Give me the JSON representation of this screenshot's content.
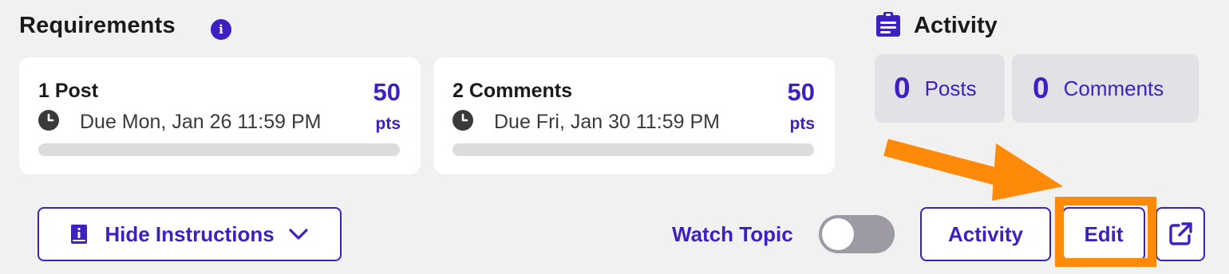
{
  "requirements": {
    "title": "Requirements",
    "info_icon": "info-icon",
    "items": [
      {
        "name": "1 Post",
        "points": "50",
        "points_unit": "pts",
        "due": "Due Mon, Jan 26 11:59 PM",
        "progress": 0
      },
      {
        "name": "2 Comments",
        "points": "50",
        "points_unit": "pts",
        "due": "Due Fri, Jan 30 11:59 PM",
        "progress": 0
      }
    ]
  },
  "activity": {
    "title": "Activity",
    "icon": "clipboard-list-icon",
    "stats": [
      {
        "count": "0",
        "label": "Posts"
      },
      {
        "count": "0",
        "label": "Comments"
      }
    ]
  },
  "toolbar": {
    "hide_instructions_label": "Hide Instructions",
    "watch_topic_label": "Watch Topic",
    "watch_topic_on": false,
    "activity_label": "Activity",
    "edit_label": "Edit",
    "external_icon": "external-link-icon"
  },
  "colors": {
    "accent": "#3d1fc2",
    "annotation": "#ff8a0a",
    "background": "#f1f1f2"
  }
}
